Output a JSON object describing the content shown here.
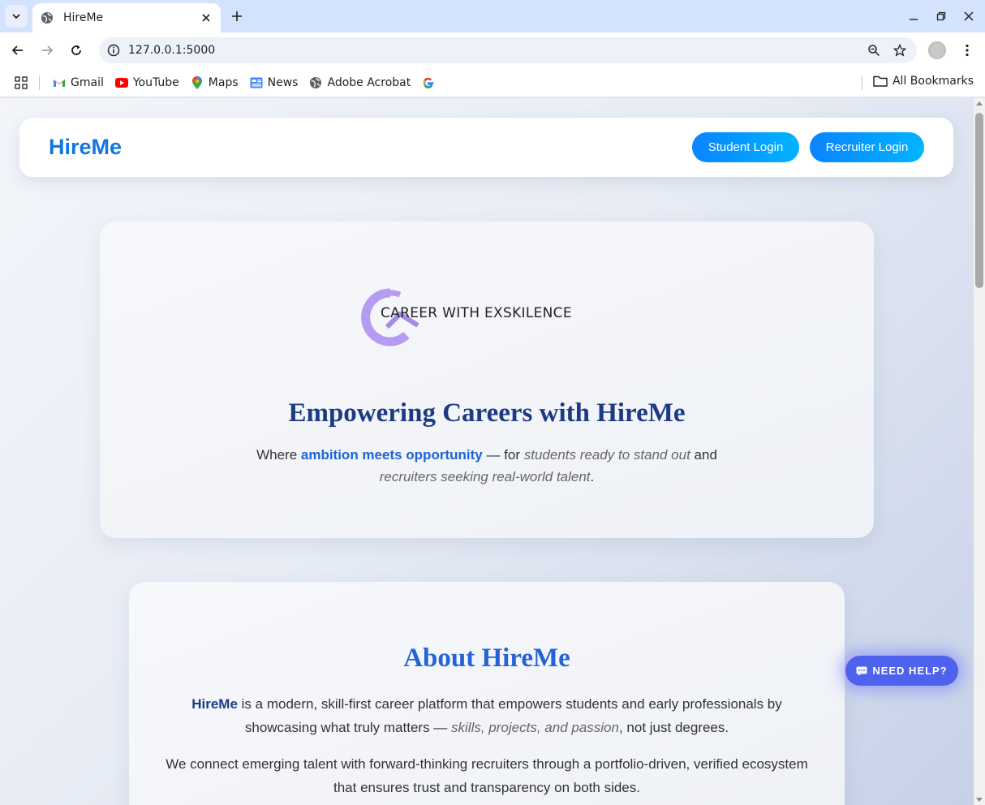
{
  "browser": {
    "tab_title": "HireMe",
    "url": "127.0.0.1:5000",
    "bookmarks": [
      {
        "label": "Gmail",
        "icon": "gmail-icon"
      },
      {
        "label": "YouTube",
        "icon": "youtube-icon"
      },
      {
        "label": "Maps",
        "icon": "maps-icon"
      },
      {
        "label": "News",
        "icon": "news-icon"
      },
      {
        "label": "Adobe Acrobat",
        "icon": "globe-icon"
      },
      {
        "label": "",
        "icon": "google-icon"
      }
    ],
    "all_bookmarks_label": "All Bookmarks"
  },
  "nav": {
    "brand": "HireMe",
    "student_login": "Student Login",
    "recruiter_login": "Recruiter Login"
  },
  "hero": {
    "logo_text": "CAREER WITH EXSKILENCE",
    "title": "Empowering Careers with HireMe",
    "tagline": {
      "prefix": "Where ",
      "highlight": "ambition meets opportunity",
      "mid1": " — for ",
      "students": "students ready to stand out",
      "mid2": " and ",
      "recruiters": "recruiters seeking real-world talent",
      "suffix": "."
    }
  },
  "about": {
    "title": "About HireMe",
    "p1": {
      "brand": "HireMe",
      "text1": " is a modern, skill-first career platform that empowers students and early professionals by showcasing what truly matters — ",
      "italic": "skills, projects, and passion",
      "text2": ", not just degrees."
    },
    "p2": "We connect emerging talent with forward-thinking recruiters through a portfolio-driven, verified ecosystem that ensures trust and transparency on both sides."
  },
  "help": {
    "label": "NEED HELP?",
    "icon": "chat-bubble-icon"
  },
  "colors": {
    "brand_blue": "#1277e1",
    "button_gradient_start": "#0a84ff",
    "button_gradient_end": "#00b4ff",
    "heading_navy": "#1d3b85",
    "about_heading": "#2463d6",
    "help_button": "#4f62ee",
    "logo_purple": "#b39cf2"
  }
}
